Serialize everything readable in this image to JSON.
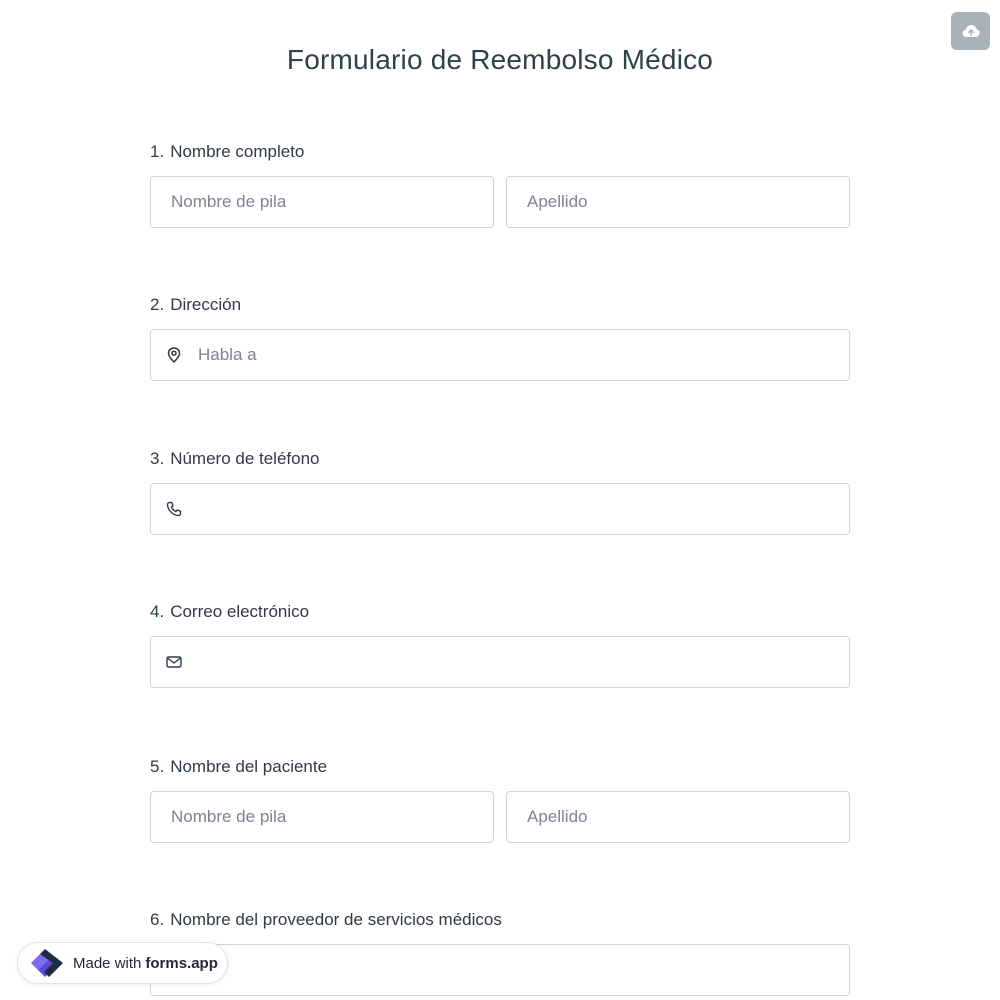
{
  "header": {
    "title": "Formulario de Reembolso Médico"
  },
  "toolbar": {
    "save_icon": "cloud-upload-icon"
  },
  "questions": [
    {
      "number": "1.",
      "label": "Nombre completo",
      "fields": [
        {
          "placeholder": "Nombre de pila",
          "value": ""
        },
        {
          "placeholder": "Apellido",
          "value": ""
        }
      ]
    },
    {
      "number": "2.",
      "label": "Dirección",
      "icon": "map-pin-icon",
      "fields": [
        {
          "placeholder": "Habla a",
          "value": ""
        }
      ]
    },
    {
      "number": "3.",
      "label": "Número de teléfono",
      "icon": "phone-icon",
      "fields": [
        {
          "placeholder": "",
          "value": ""
        }
      ]
    },
    {
      "number": "4.",
      "label": "Correo electrónico",
      "icon": "envelope-icon",
      "fields": [
        {
          "placeholder": "",
          "value": ""
        }
      ]
    },
    {
      "number": "5.",
      "label": "Nombre del paciente",
      "fields": [
        {
          "placeholder": "Nombre de pila",
          "value": ""
        },
        {
          "placeholder": "Apellido",
          "value": ""
        }
      ]
    },
    {
      "number": "6.",
      "label": "Nombre del proveedor de servicios médicos",
      "fields": [
        {
          "placeholder": "",
          "value": ""
        }
      ]
    }
  ],
  "footer_badge": {
    "prefix": "Made with",
    "brand": "forms.app",
    "logo_icon": "forms-app-logo-icon",
    "colors": {
      "primary": "#6c5ce7",
      "dark": "#1f2a44"
    }
  },
  "colors": {
    "title": "#2f4249",
    "text": "#2f3b44",
    "border": "#cfd4d8",
    "save_button": "#a9b2b8"
  }
}
